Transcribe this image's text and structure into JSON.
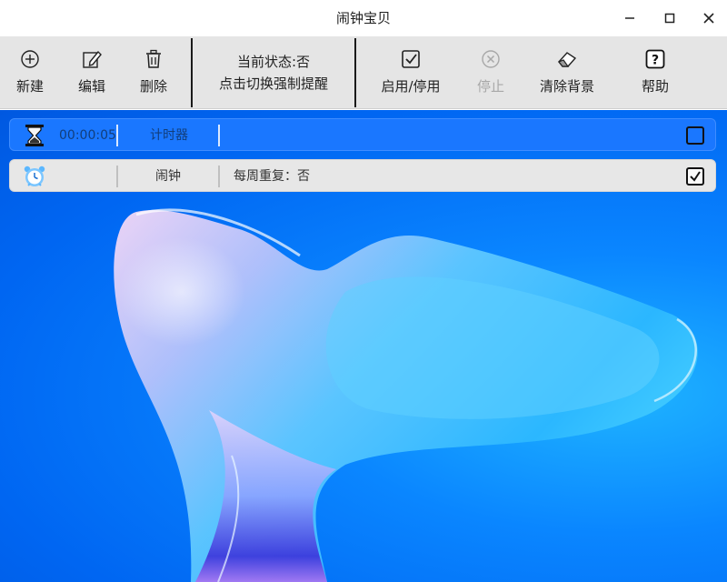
{
  "window": {
    "title": "闹钟宝贝"
  },
  "toolbar": {
    "new_label": "新建",
    "edit_label": "编辑",
    "delete_label": "删除",
    "status_line1": "当前状态:否",
    "status_line2": "点击切换强制提醒",
    "toggle_label": "启用/停用",
    "stop_label": "停止",
    "clear_bg_label": "清除背景",
    "help_label": "帮助"
  },
  "rows": [
    {
      "time": "00:00:05",
      "type": "计时器",
      "repeat": "",
      "checked": false
    },
    {
      "time": "",
      "type": "闹钟",
      "repeat": "每周重复：否",
      "checked": true
    }
  ],
  "colors": {
    "toolbar_bg": "#e5e5e5",
    "timer_row_bg": "#1a77ff",
    "alarm_row_bg": "#e7e7e7",
    "background_blue": "#0066f2"
  }
}
